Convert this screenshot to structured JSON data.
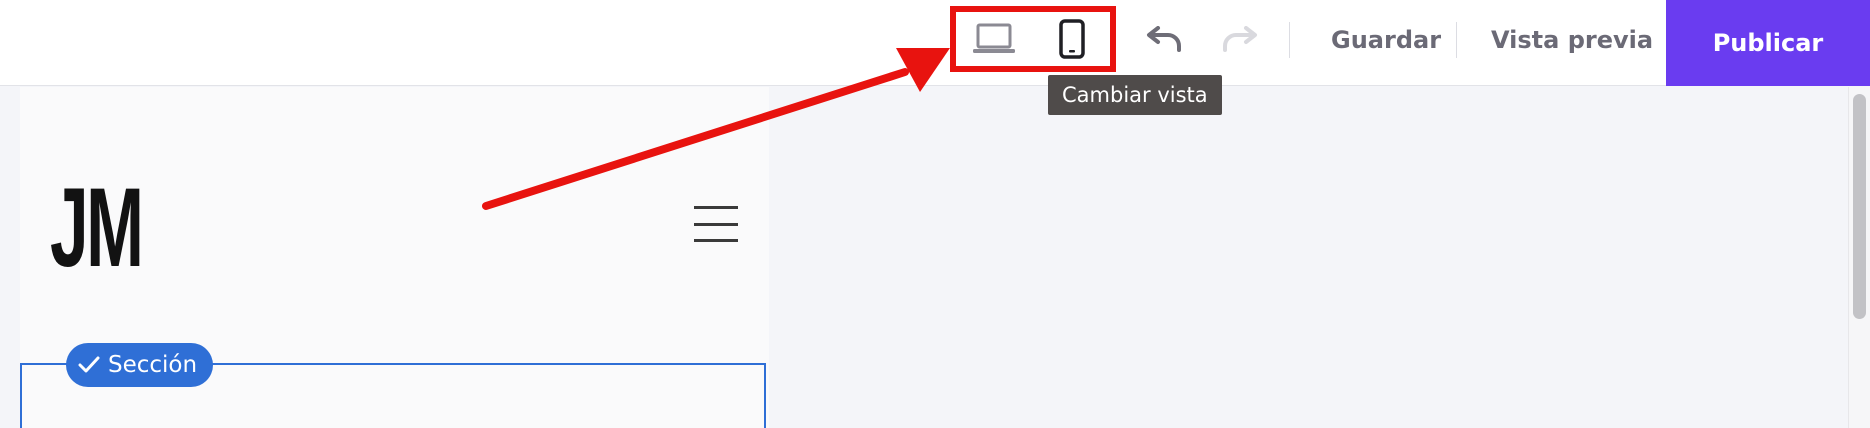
{
  "toolbar": {
    "guardar_label": "Guardar",
    "vista_previa_label": "Vista previa",
    "publicar_label": "Publicar",
    "tooltip_text": "Cambiar vista",
    "devices": [
      {
        "name": "desktop",
        "icon": "laptop-icon",
        "active": false
      },
      {
        "name": "mobile",
        "icon": "phone-icon",
        "active": true
      }
    ],
    "history": [
      {
        "name": "undo",
        "icon": "undo-icon",
        "enabled": true
      },
      {
        "name": "redo",
        "icon": "redo-icon",
        "enabled": false
      }
    ]
  },
  "canvas": {
    "logo_text": "JM",
    "menu_icon": "hamburger-icon",
    "section_badge_label": "Sección",
    "section_badge_icon": "check-icon"
  },
  "annotation": {
    "highlight_color": "#e8130f",
    "arrow_color": "#e8130f"
  },
  "colors": {
    "publish_bg": "#6a3cf0",
    "section_blue": "#2f6fd6",
    "tooltip_bg": "#4f4b4a"
  }
}
